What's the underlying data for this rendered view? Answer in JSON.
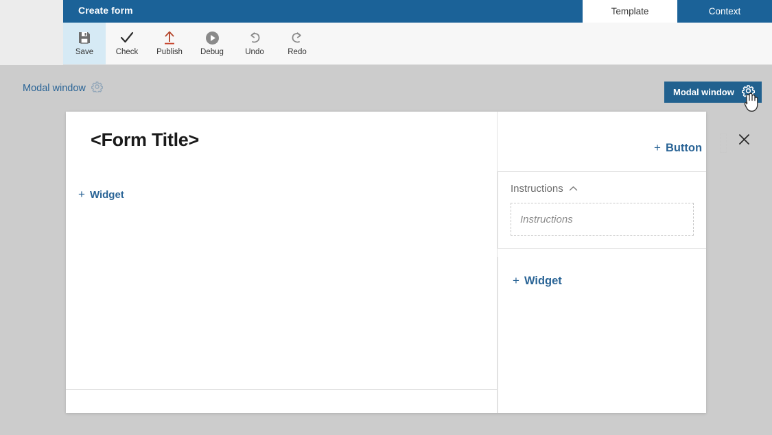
{
  "window": {
    "title": "Create form",
    "header_color": "#1b6298",
    "accent_link_color": "#2a6496"
  },
  "nav": {
    "back_icon": "chevron-left-icon"
  },
  "tabs": [
    {
      "label": "Template",
      "active": true
    },
    {
      "label": "Context",
      "active": false
    }
  ],
  "toolbar": {
    "items": [
      {
        "label": "Save",
        "icon": "floppy-disk-icon",
        "active": true
      },
      {
        "label": "Check",
        "icon": "checkmark-icon",
        "active": false
      },
      {
        "label": "Publish",
        "icon": "upload-arrow-icon",
        "active": false
      },
      {
        "label": "Debug",
        "icon": "play-circle-icon",
        "active": false
      },
      {
        "label": "Undo",
        "icon": "undo-arrow-icon",
        "active": false
      },
      {
        "label": "Redo",
        "icon": "redo-arrow-icon",
        "active": false
      }
    ]
  },
  "canvas": {
    "label": "Modal window",
    "label_gear_icon": "gear-icon",
    "selected_tag": {
      "label": "Modal window",
      "gear_icon": "gear-icon",
      "background_color": "#21618f"
    },
    "cursor_icon": "hand-pointer-cursor"
  },
  "modal": {
    "form_title": "<Form Title>",
    "add_widget_left": "Widget",
    "add_button": "Button",
    "close_icon": "close-icon",
    "dashed_slot_name": "empty-drop-slot",
    "instructions": {
      "heading": "Instructions",
      "collapse_icon": "chevron-up-icon",
      "placeholder": "Instructions"
    },
    "add_widget_right": "Widget",
    "plus_glyph": "+"
  }
}
